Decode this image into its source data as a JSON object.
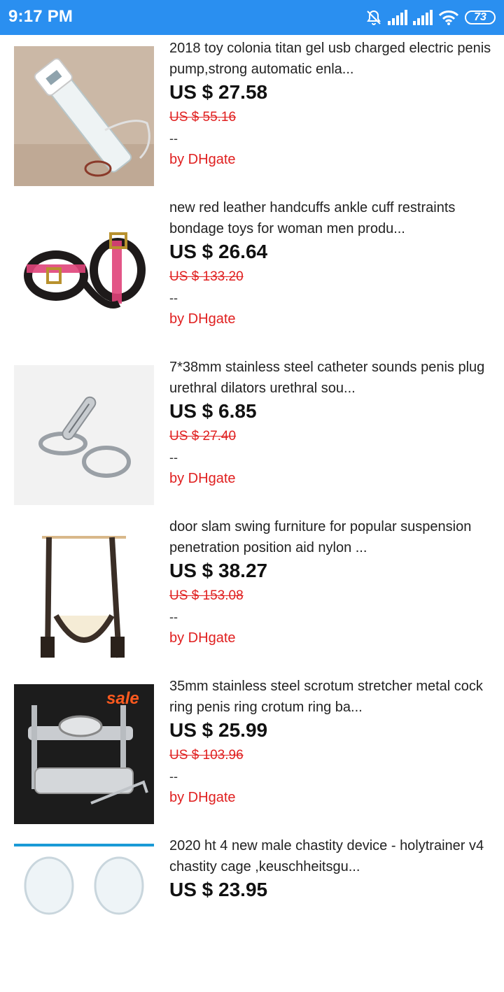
{
  "status_bar": {
    "time": "9:17 PM",
    "battery": "73",
    "icons": [
      "alarm-off-icon",
      "signal-icon",
      "signal-icon",
      "wifi-icon",
      "battery-icon"
    ]
  },
  "products": [
    {
      "title": "2018 toy colonia titan gel usb charged electric penis pump,strong automatic enla...",
      "price": "US $ 27.58",
      "old_price": "US $ 55.16",
      "dash": "--",
      "seller": "by DHgate"
    },
    {
      "title": "new red leather handcuffs ankle cuff restraints bondage toys for woman men produ...",
      "price": "US $ 26.64",
      "old_price": "US $ 133.20",
      "dash": "--",
      "seller": "by DHgate"
    },
    {
      "title": "7*38mm stainless steel catheter sounds penis plug urethral dilators urethral sou...",
      "price": "US $ 6.85",
      "old_price": "US $ 27.40",
      "dash": "--",
      "seller": "by DHgate"
    },
    {
      "title": "door slam swing furniture for popular suspension penetration position aid nylon ...",
      "price": "US $ 38.27",
      "old_price": "US $ 153.08",
      "dash": "--",
      "seller": "by DHgate"
    },
    {
      "title": "35mm stainless steel scrotum stretcher metal cock ring penis ring crotum ring ba...",
      "price": "US $ 25.99",
      "old_price": "US $ 103.96",
      "dash": "--",
      "seller": "by DHgate",
      "image_badge": "sale"
    },
    {
      "title": "2020 ht 4 new male chastity device - holytrainer v4 chastity cage ,keuschheitsgu...",
      "price": "US $ 23.95",
      "old_price": "",
      "dash": "",
      "seller": ""
    }
  ],
  "colors": {
    "status_bar": "#2a8ff0",
    "price": "#111111",
    "old_price": "#e02020",
    "seller": "#e02020"
  }
}
